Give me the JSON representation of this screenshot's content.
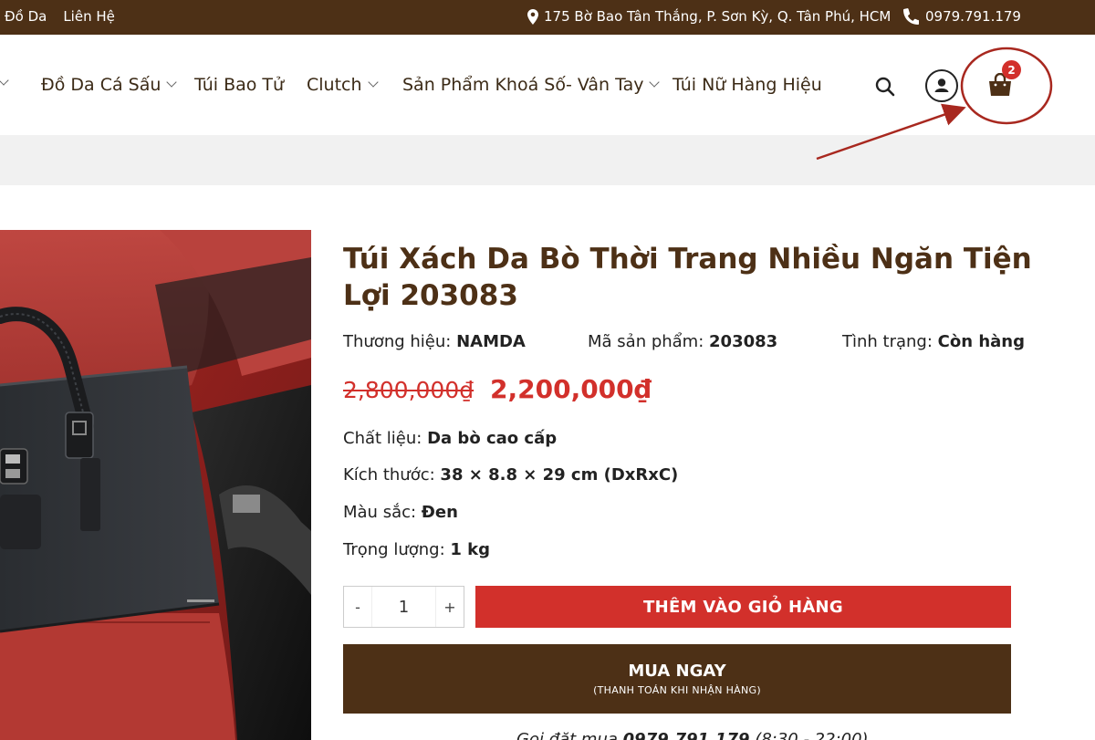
{
  "topbar": {
    "link_products": "c Đồ Da",
    "link_contact": "Liên Hệ",
    "address": "175 Bờ Bao Tân Thắng, P. Sơn Kỳ, Q. Tân Phú, HCM",
    "phone": "0979.791.179"
  },
  "nav": {
    "items": [
      {
        "label": "Đồ Da Cá Sấu",
        "dropdown": true
      },
      {
        "label": "Túi Bao Tử",
        "dropdown": false
      },
      {
        "label": "Clutch",
        "dropdown": true
      },
      {
        "label": "Sản Phẩm Khoá Số- Vân Tay",
        "dropdown": true
      },
      {
        "label": "Túi Nữ Hàng Hiệu",
        "dropdown": false
      }
    ],
    "cart_count": "2"
  },
  "product": {
    "title": "Túi Xách Da Bò Thời Trang Nhiều Ngăn Tiện Lợi 203083",
    "brand_label": "Thương hiệu:",
    "brand": "NAMDA",
    "sku_label": "Mã sản phẩm:",
    "sku": "203083",
    "status_label": "Tình trạng:",
    "status": "Còn hàng",
    "old_price": "2,800,000₫",
    "new_price": "2,200,000₫",
    "specs": [
      {
        "label": "Chất liệu:",
        "value": "Da bò cao cấp"
      },
      {
        "label": "Kích thước:",
        "value": "38 × 8.8 × 29 cm (DxRxC)"
      },
      {
        "label": "Màu sắc:",
        "value": "Đen"
      },
      {
        "label": "Trọng lượng:",
        "value": "1 kg"
      }
    ]
  },
  "purchase": {
    "qty_minus": "-",
    "qty_value": "1",
    "qty_plus": "+",
    "add_to_cart": "THÊM VÀO GIỎ HÀNG",
    "buy_now": "MUA NGAY",
    "buy_now_sub": "(THANH TOÁN KHI NHẬN HÀNG)",
    "call_prefix": "Gọi đặt mua",
    "call_phone": "0979.791.179",
    "call_hours": "(8:30 - 22:00)"
  },
  "colors": {
    "brand_brown": "#4d3016",
    "accent_red": "#d2302b",
    "annotation_red": "#a8281f"
  },
  "icons": [
    "map-pin-icon",
    "phone-icon",
    "search-icon",
    "user-icon",
    "shopping-bag-icon"
  ]
}
